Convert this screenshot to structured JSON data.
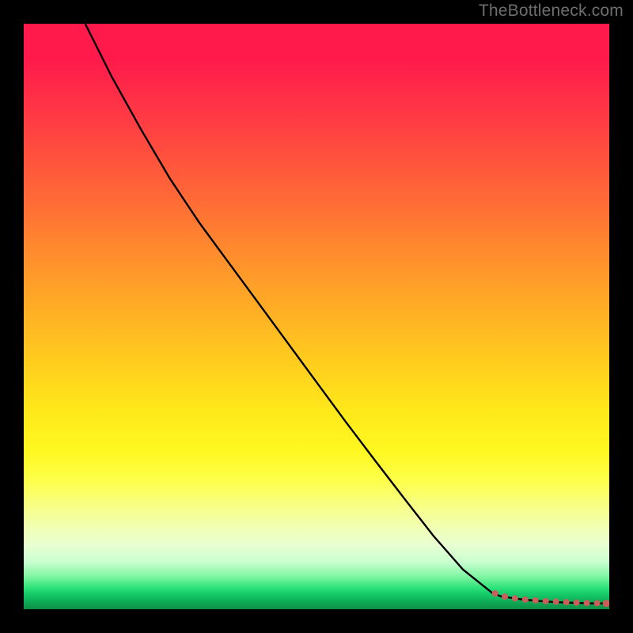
{
  "watermark": "TheBottleneck.com",
  "colors": {
    "background": "#000000",
    "curve": "#000000",
    "dotted": "#ca5f5a",
    "marker": "#ca5f5a"
  },
  "chart_data": {
    "type": "line",
    "title": "",
    "xlabel": "",
    "ylabel": "",
    "xlim": [
      0,
      100
    ],
    "ylim": [
      0,
      100
    ],
    "grid": false,
    "series": [
      {
        "name": "bottleneck-curve",
        "style": "solid-black",
        "x": [
          10.5,
          15,
          20,
          25,
          30,
          35,
          40,
          45,
          50,
          55,
          60,
          65,
          70,
          75,
          80,
          81.5,
          85,
          88,
          91,
          94,
          97,
          100
        ],
        "y": [
          100,
          91,
          82,
          73.5,
          66,
          59.2,
          52.4,
          45.6,
          38.8,
          32,
          25.4,
          18.9,
          12.5,
          6.8,
          2.8,
          2.2,
          1.7,
          1.4,
          1.2,
          1.1,
          1.0,
          1.0
        ]
      },
      {
        "name": "selected-range",
        "style": "dotted-red",
        "x": [
          80.5,
          82,
          83.5,
          85,
          87,
          89,
          91,
          93,
          95,
          97,
          99.5
        ],
        "y": [
          2.7,
          2.2,
          1.9,
          1.7,
          1.55,
          1.4,
          1.3,
          1.2,
          1.1,
          1.05,
          1.0
        ]
      }
    ],
    "annotations": []
  }
}
